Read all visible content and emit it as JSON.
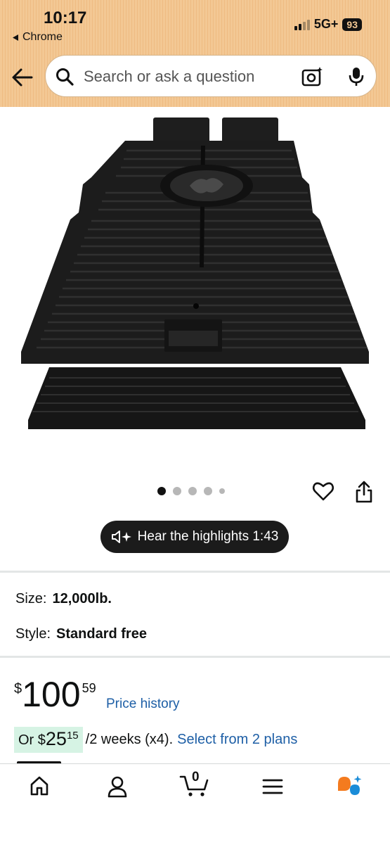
{
  "status_bar": {
    "time": "10:17",
    "back_app": "Chrome",
    "network": "5G+",
    "battery": "93"
  },
  "search": {
    "placeholder": "Search or ask a question",
    "back_icon": "back-arrow-icon",
    "search_icon": "search-icon",
    "camera_icon": "camera-icon",
    "mic_icon": "microphone-icon"
  },
  "gallery": {
    "image_count": 5,
    "active_index": 0,
    "favorite_icon": "heart-icon",
    "share_icon": "share-icon"
  },
  "highlights": {
    "label": "Hear the highlights 1:43",
    "icon": "speaker-sparkle-icon"
  },
  "specs": {
    "size_label": "Size:",
    "size_value": "12,000lb.",
    "style_label": "Style:",
    "style_value": "Standard free"
  },
  "price": {
    "symbol": "$",
    "whole": "100",
    "fraction": "59",
    "history_link": "Price history"
  },
  "installment": {
    "prefix": "Or",
    "symbol": "$",
    "whole": "25",
    "fraction": "15",
    "terms": "/2 weeks (x4).",
    "link": "Select from 2 plans"
  },
  "tabbar": {
    "items": [
      {
        "icon": "home-icon"
      },
      {
        "icon": "account-icon"
      },
      {
        "icon": "cart-icon",
        "count": "0"
      },
      {
        "icon": "menu-icon"
      },
      {
        "icon": "rufus-assistant-icon"
      }
    ],
    "accent": "#f47b1f",
    "assistant_blue": "#1a8cd8"
  }
}
